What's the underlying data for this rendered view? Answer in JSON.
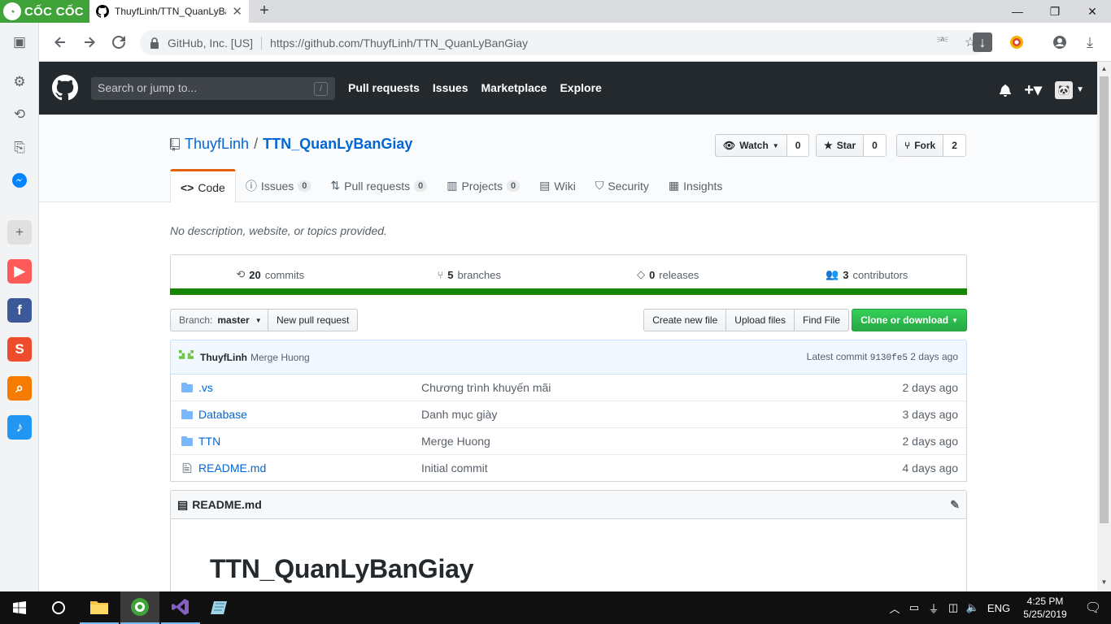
{
  "browser": {
    "brand": "CỐC CỐC",
    "tab_title": "ThuyfLinh/TTN_QuanLyBa",
    "address_org": "GitHub, Inc. [US]",
    "address_url": "https://github.com/ThuyfLinh/TTN_QuanLyBanGiay"
  },
  "github": {
    "search_placeholder": "Search or jump to...",
    "search_key": "/",
    "nav": [
      "Pull requests",
      "Issues",
      "Marketplace",
      "Explore"
    ]
  },
  "repo": {
    "owner": "ThuyfLinh",
    "separator": "/",
    "name": "TTN_QuanLyBanGiay",
    "watch_label": "Watch",
    "watch_count": "0",
    "star_label": "Star",
    "star_count": "0",
    "fork_label": "Fork",
    "fork_count": "2",
    "tabs": [
      {
        "label": "Code",
        "count": ""
      },
      {
        "label": "Issues",
        "count": "0"
      },
      {
        "label": "Pull requests",
        "count": "0"
      },
      {
        "label": "Projects",
        "count": "0"
      },
      {
        "label": "Wiki",
        "count": ""
      },
      {
        "label": "Security",
        "count": ""
      },
      {
        "label": "Insights",
        "count": ""
      }
    ],
    "description": "No description, website, or topics provided.",
    "summary": {
      "commits_num": "20",
      "commits_label": "commits",
      "branches_num": "5",
      "branches_label": "branches",
      "releases_num": "0",
      "releases_label": "releases",
      "contributors_num": "3",
      "contributors_label": "contributors"
    },
    "language_color": "#178600",
    "branch_prefix": "Branch:",
    "branch_name": "master",
    "new_pr_label": "New pull request",
    "create_file_label": "Create new file",
    "upload_label": "Upload files",
    "find_label": "Find File",
    "clone_label": "Clone or download",
    "commit": {
      "author": "ThuyfLinh",
      "message": "Merge Huong",
      "latest_label": "Latest commit",
      "sha": "9130fe5",
      "age": "2 days ago"
    },
    "files": [
      {
        "name": ".vs",
        "type": "dir",
        "message": "Chương trình khuyến mãi",
        "age": "2 days ago"
      },
      {
        "name": "Database",
        "type": "dir",
        "message": "Danh mục giày",
        "age": "3 days ago"
      },
      {
        "name": "TTN",
        "type": "dir",
        "message": "Merge Huong",
        "age": "2 days ago"
      },
      {
        "name": "README.md",
        "type": "file",
        "message": "Initial commit",
        "age": "4 days ago"
      }
    ],
    "readme_filename": "README.md",
    "readme_heading": "TTN_QuanLyBanGiay"
  },
  "taskbar": {
    "lang": "ENG",
    "time": "4:25 PM",
    "date": "5/25/2019"
  }
}
